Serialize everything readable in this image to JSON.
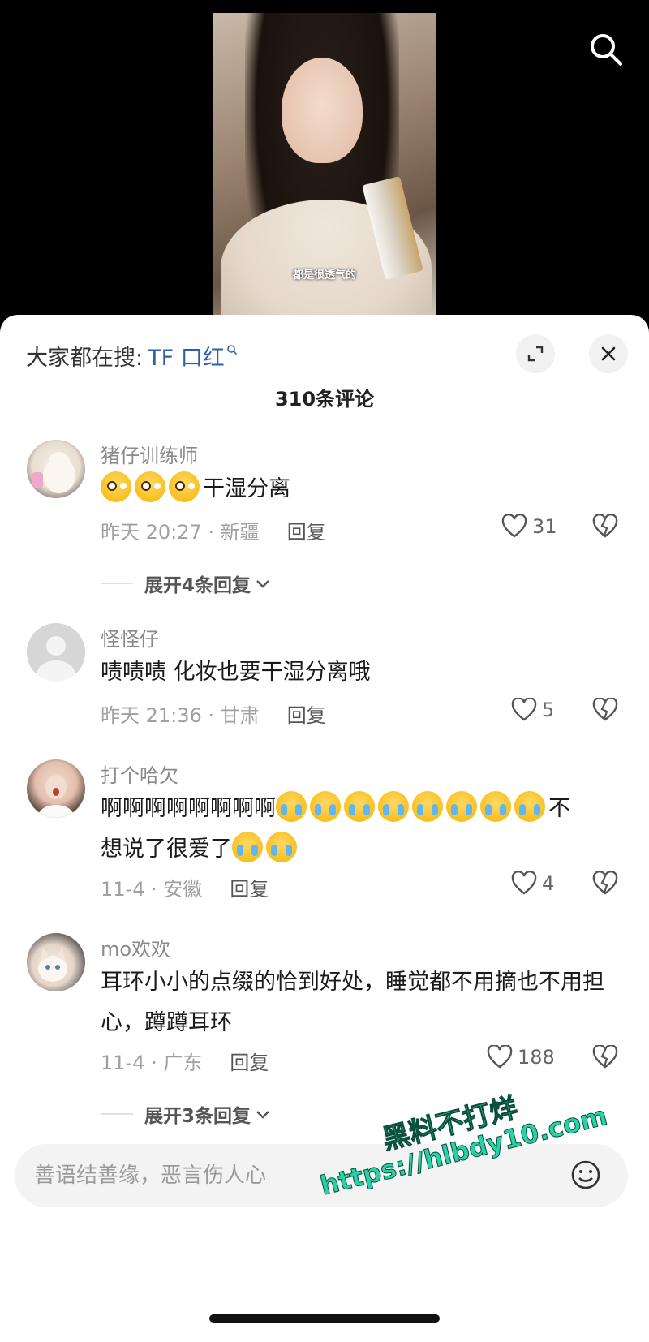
{
  "video": {
    "caption": "都是很透气的"
  },
  "header": {
    "search_hint": "大家都在搜:",
    "search_keyword": "TF 口红"
  },
  "comment_count": "310条评论",
  "comments": [
    {
      "user": "猪仔训练师",
      "emojis": 3,
      "text": "干湿分离",
      "time_location": "昨天 20:27 · 新疆",
      "reply_label": "回复",
      "likes": "31",
      "expand_label": "展开4条回复"
    },
    {
      "user": "怪怪仔",
      "text": "啧啧啧 化妆也要干湿分离哦",
      "time_location": "昨天 21:36 · 甘肃",
      "reply_label": "回复",
      "likes": "5"
    },
    {
      "user": "打个哈欠",
      "text_a": "啊啊啊啊啊啊啊啊",
      "text_b": "不",
      "text_c": "想说了很爱了",
      "time_location": "11-4 · 安徽",
      "reply_label": "回复",
      "likes": "4"
    },
    {
      "user": "mo欢欢",
      "text": "耳环小小的点缀的恰到好处，睡觉都不用摘也不用担心，蹲蹲耳环",
      "time_location": "11-4 · 广东",
      "reply_label": "回复",
      "likes": "188",
      "expand_label": "展开3条回复"
    }
  ],
  "input": {
    "placeholder": "善语结善缘，恶言伤人心"
  },
  "watermark": {
    "title": "黑料不打烊",
    "url": "https://hlbdy10.com"
  },
  "colors": {
    "keyword": "#2e5fa8",
    "watermark": "#26d3a9"
  }
}
